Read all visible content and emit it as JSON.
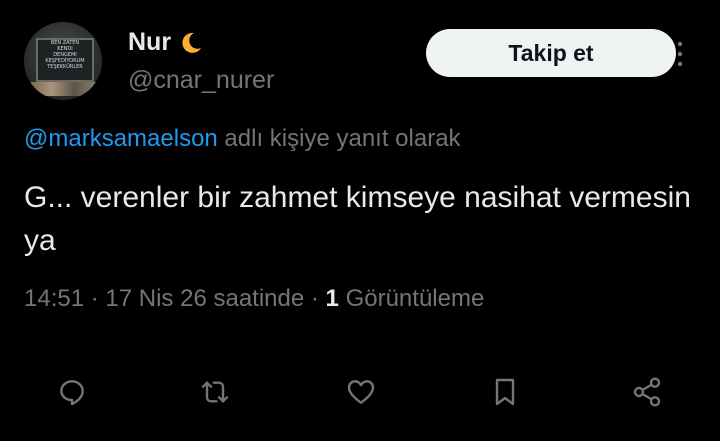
{
  "author": {
    "display_name": "Nur",
    "handle": "@cnar_nurer",
    "avatar_board_lines": [
      "BEN ZATEN",
      "KENDI",
      "DENGEMI",
      "KEŞFEDİYORUM",
      "TEŞEKKÜRLER"
    ]
  },
  "follow": {
    "label": "Takip et"
  },
  "reply_context": {
    "mention": "@marksamaelson",
    "suffix": " adlı kişiye yanıt olarak"
  },
  "tweet": {
    "text": "G... verenler bir zahmet kimseye nasihat vermesin ya"
  },
  "meta": {
    "time": "14:51",
    "date": "17 Nis 26 saatinde",
    "view_count": "1",
    "view_label": "Görüntüleme"
  },
  "icons": {
    "moon": "crescent-moon-icon",
    "more": "more-vertical-icon",
    "reply": "reply-icon",
    "retweet": "retweet-icon",
    "like": "heart-icon",
    "bookmark": "bookmark-icon",
    "share": "share-icon"
  },
  "colors": {
    "background": "#000000",
    "text": "#e7e9ea",
    "muted": "#71767b",
    "accent": "#1d9bf0",
    "moon": "#ffac33",
    "button_bg": "#eff3f4"
  }
}
